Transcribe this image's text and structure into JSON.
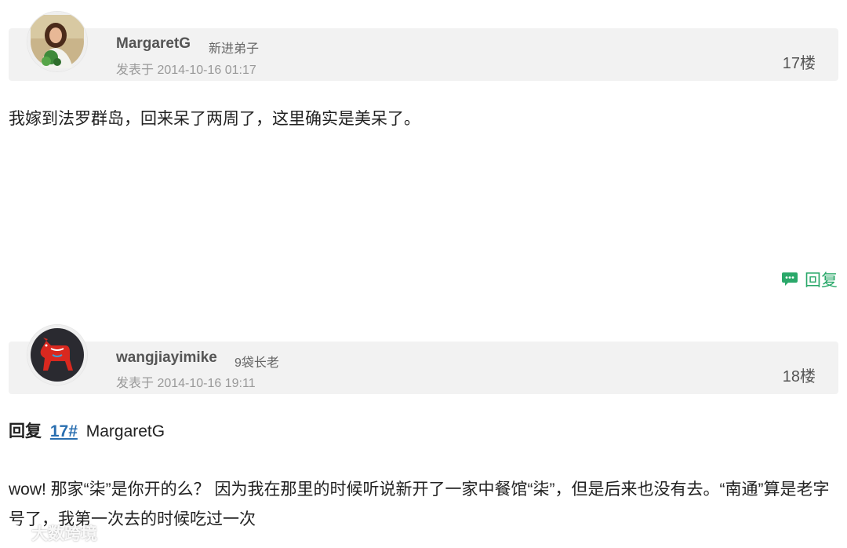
{
  "posts": [
    {
      "username": "MargaretG",
      "rank": "新进弟子",
      "time": "发表于 2014-10-16 01:17",
      "floor": "17楼",
      "content": "我嫁到法罗群岛，回来呆了两周了，这里确实是美呆了。",
      "reply_label": "回复"
    },
    {
      "username": "wangjiayimike",
      "rank": "9袋长老",
      "time": "发表于 2014-10-16 19:11",
      "floor": "18楼",
      "quote_prefix": "回复",
      "quote_floor": "17#",
      "quote_user": "MargaretG",
      "content": "wow! 那家“柒”是你开的么？ 因为我在那里的时候听说新开了一家中餐馆“柒”，但是后来也没有去。“南通”算是老字号了，我第一次去的时候吃过一次"
    }
  ],
  "watermark": "大数跨境",
  "colors": {
    "header_bg": "#f2f2f2",
    "reply_green": "#2aa86a",
    "link_blue": "#2a6fb0"
  },
  "icons": {
    "reply": "chat-bubble-icon",
    "watermark": "logo-icon"
  }
}
